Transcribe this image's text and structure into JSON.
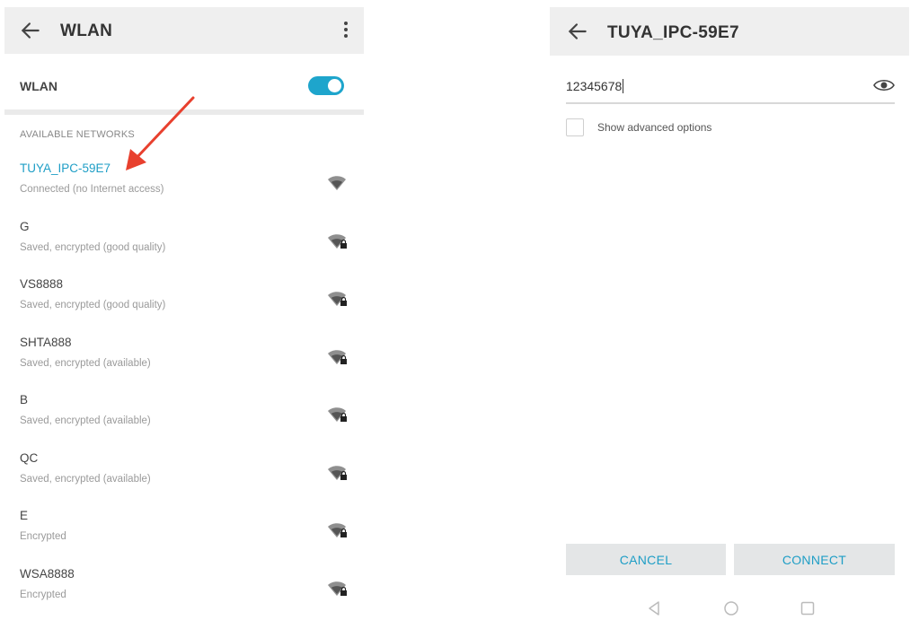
{
  "left_screen": {
    "title": "WLAN",
    "back_icon": "arrow-left-icon",
    "menu_icon": "more-vert-icon",
    "wlan_label": "WLAN",
    "wlan_enabled": true,
    "section_header": "AVAILABLE NETWORKS",
    "networks": [
      {
        "name": "TUYA_IPC-59E7",
        "status": "Connected (no Internet access)",
        "connected": true,
        "secured": false
      },
      {
        "name": "G",
        "status": "Saved, encrypted (good quality)",
        "connected": false,
        "secured": true
      },
      {
        "name": "VS8888",
        "status": "Saved, encrypted (good quality)",
        "connected": false,
        "secured": true
      },
      {
        "name": "SHTA888",
        "status": "Saved, encrypted (available)",
        "connected": false,
        "secured": true
      },
      {
        "name": "B",
        "status": "Saved, encrypted (available)",
        "connected": false,
        "secured": true
      },
      {
        "name": "QC",
        "status": "Saved, encrypted (available)",
        "connected": false,
        "secured": true
      },
      {
        "name": "E",
        "status": "Encrypted",
        "connected": false,
        "secured": true
      },
      {
        "name": "WSA8888",
        "status": "Encrypted",
        "connected": false,
        "secured": true
      }
    ]
  },
  "right_screen": {
    "title": "TUYA_IPC-59E7",
    "back_icon": "arrow-left-icon",
    "password_value": "12345678",
    "eye_icon": "eye-icon",
    "advanced_options_label": "Show advanced options",
    "advanced_options_checked": false,
    "cancel_label": "CANCEL",
    "connect_label": "CONNECT",
    "nav_icons": [
      "back-triangle-icon",
      "home-circle-icon",
      "recents-square-icon"
    ]
  },
  "colors": {
    "accent": "#1e9ec6",
    "toggle_on": "#1ea5cc",
    "annotation_arrow": "#e8402e",
    "appbar_bg": "#efefef",
    "button_bg": "#e4e6e7"
  }
}
